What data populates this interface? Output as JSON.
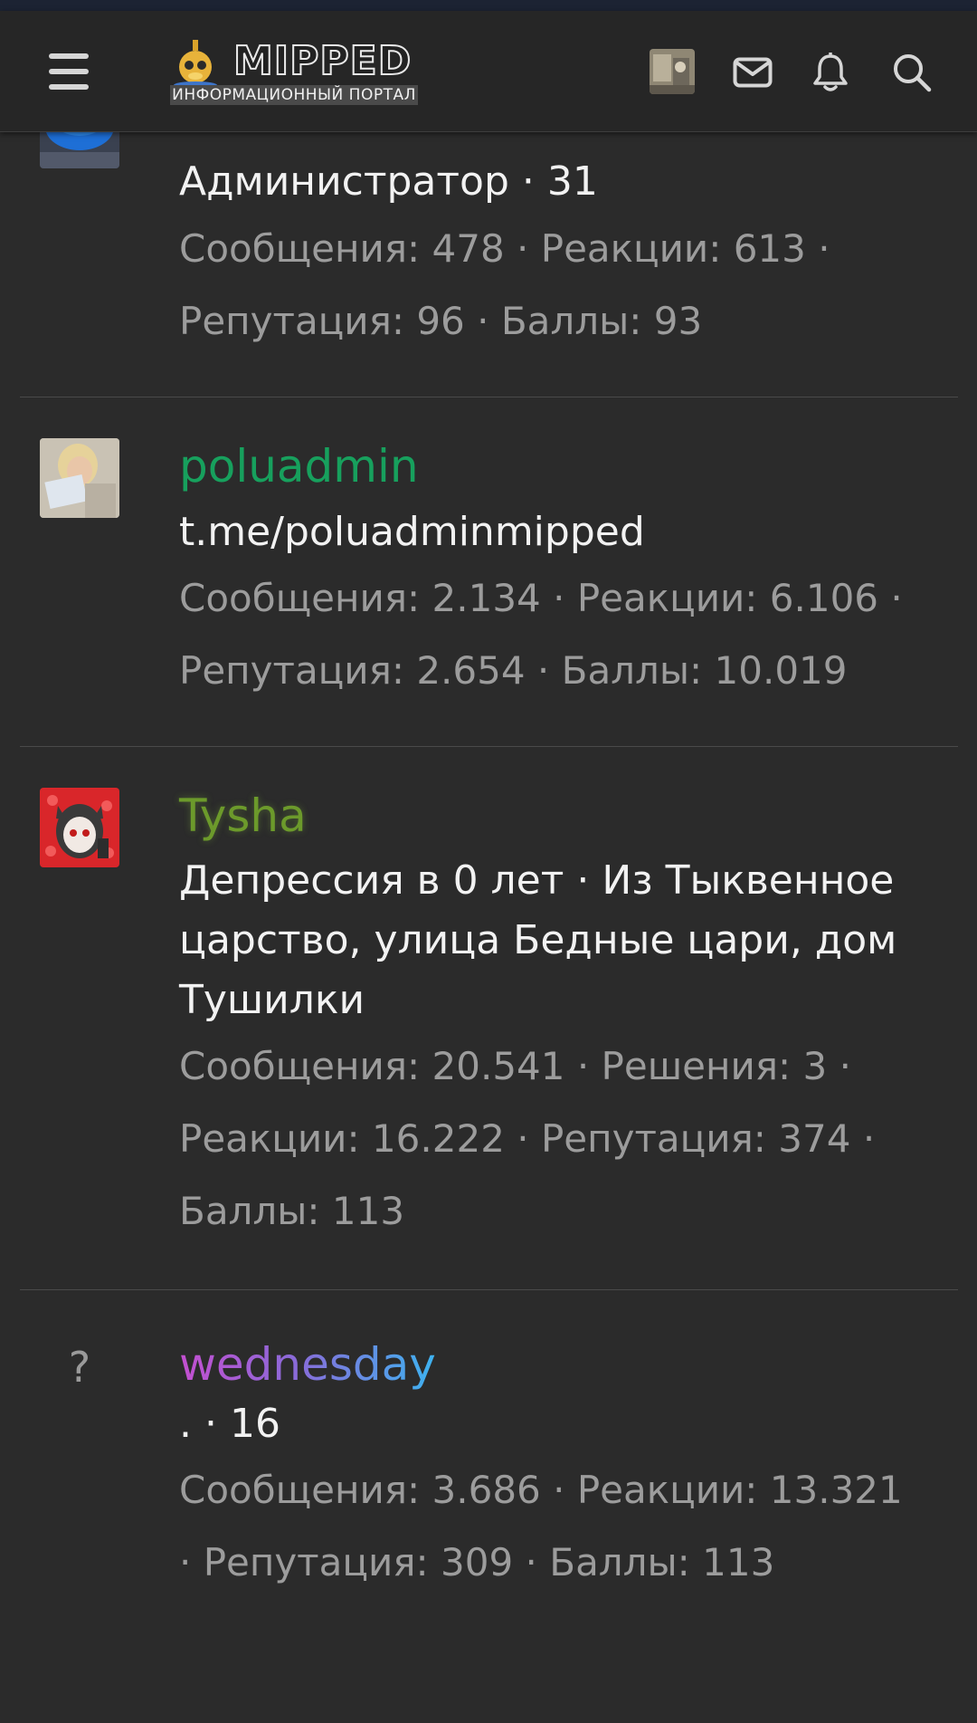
{
  "header": {
    "logo_title": "MIPPED",
    "logo_subtitle": "ИНФОРМАЦИОННЫЙ ПОРТАЛ"
  },
  "icons": {
    "menu": "hamburger-icon",
    "messages": "envelope-icon",
    "alerts": "bell-icon",
    "search": "search-icon"
  },
  "colors": {
    "background": "#2b2b2b",
    "header": "#262626",
    "username_poluadmin": "#17a05d",
    "username_tysha": "#6c9a2b",
    "username_wednesday_start": "#c44fd0",
    "username_wednesday_end": "#3db3f0",
    "stats_text": "#9c9c9c"
  },
  "members": [
    {
      "name": "",
      "title": "Администратор · 31",
      "stats": "Сообщения: 478 · Реакции: 613 · Репутация: 96 · Баллы: 93"
    },
    {
      "name": "poluadmin",
      "title": "t.me/poluadminmipped",
      "stats": "Сообщения: 2.134 · Реакции: 6.106 · Репутация: 2.654 · Баллы: 10.019"
    },
    {
      "name": "Tysha",
      "title": "Депрессия в 0 лет · Из Тыквенное царство, улица Бедные цари, дом Тушилки",
      "stats": "Сообщения: 20.541 · Решения: 3 · Реакции: 16.222 · Репутация: 374 · Баллы: 113"
    },
    {
      "name": "wednesday",
      "avatar_placeholder": "?",
      "title": ". · 16",
      "stats": "Сообщения: 3.686 · Реакции: 13.321 · Репутация: 309 · Баллы: 113"
    }
  ]
}
